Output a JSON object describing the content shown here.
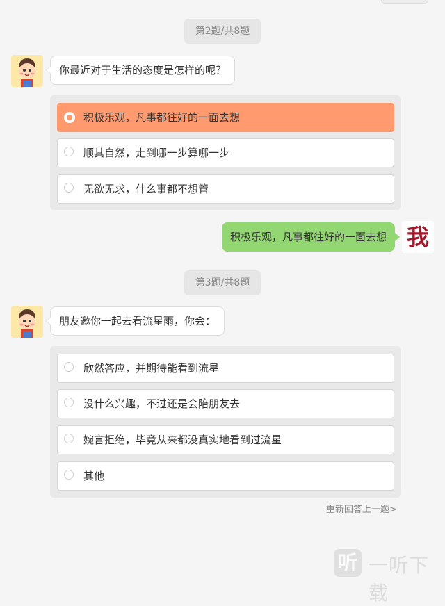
{
  "question2": {
    "counter": "第2题/共8题",
    "question": "你最近对于生活的态度是怎样的呢？",
    "options": [
      {
        "label": "积极乐观，凡事都往好的一面去想",
        "selected": true
      },
      {
        "label": "顺其自然，走到哪一步算哪一步",
        "selected": false
      },
      {
        "label": "无欲无求，什么事都不想管",
        "selected": false
      }
    ]
  },
  "answer2": {
    "text": "积极乐观，凡事都往好的一面去想",
    "avatar_text": "我"
  },
  "question3": {
    "counter": "第3题/共8题",
    "question": "朋友邀你一起去看流星雨，你会：",
    "options": [
      {
        "label": "欣然答应，并期待能看到流星",
        "selected": false
      },
      {
        "label": "没什么兴趣，不过还是会陪朋友去",
        "selected": false
      },
      {
        "label": "婉言拒绝，毕竟从来都没真实地看到过流星",
        "selected": false
      },
      {
        "label": "其他",
        "selected": false
      }
    ]
  },
  "redo_link": "重新回答上一题>",
  "watermark": {
    "icon_text": "听",
    "text": "一听下载"
  },
  "colors": {
    "selected_option": "#ff9a6e",
    "my_bubble": "#93d772",
    "my_avatar_text": "#a5172a",
    "avatar_bg": "#fde8a8"
  }
}
